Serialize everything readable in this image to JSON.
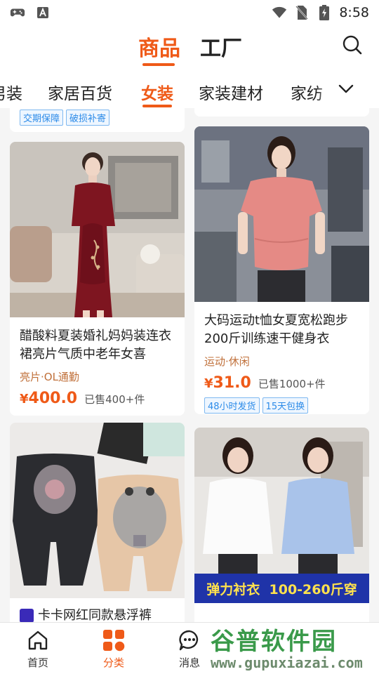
{
  "status_bar": {
    "time": "8:58",
    "left_icons": [
      "gamepad-icon",
      "a-letter-icon"
    ],
    "right_icons": [
      "wifi-icon",
      "no-sim-icon",
      "battery-charging-icon"
    ]
  },
  "header": {
    "tabs": [
      {
        "label": "商品",
        "active": true
      },
      {
        "label": "工厂",
        "active": false
      }
    ],
    "search_icon": "search-icon"
  },
  "categories": {
    "items": [
      {
        "label": "男装",
        "active": false
      },
      {
        "label": "家居百货",
        "active": false
      },
      {
        "label": "女装",
        "active": true
      },
      {
        "label": "家装建材",
        "active": false
      },
      {
        "label": "家纺",
        "active": false
      }
    ],
    "expand_icon": "chevron-down-icon"
  },
  "feed": {
    "partial_top_badges": [
      "交期保障",
      "破损补寄"
    ],
    "products": [
      {
        "title": "醋酸料夏装婚礼妈妈装连衣裙亮片气质中老年女喜",
        "tag": "亮片·OL通勤",
        "price_symbol": "¥",
        "price": "400.0",
        "sold": "已售400+件",
        "badges": []
      },
      {
        "title": "大码运动t恤女夏宽松跑步200斤训练速干健身衣",
        "tag": "运动·休闲",
        "price_symbol": "¥",
        "price": "31.0",
        "sold": "已售1000+件",
        "badges": [
          "48小时发货",
          "15天包换"
        ]
      },
      {
        "title": "卡卡网红同款悬浮裤",
        "tag": "",
        "price_symbol": "",
        "price": "",
        "sold": "",
        "badges": []
      },
      {
        "title": "",
        "image_banner": "弹力衬衣  100-260斤穿",
        "tag": "",
        "price_symbol": "",
        "price": "",
        "sold": "",
        "badges": []
      }
    ]
  },
  "bottom_nav": {
    "items": [
      {
        "label": "首页",
        "icon": "home-icon",
        "active": false
      },
      {
        "label": "分类",
        "icon": "category-grid-icon",
        "active": true
      },
      {
        "label": "消息",
        "icon": "message-icon",
        "active": false
      }
    ]
  },
  "watermark": {
    "title": "谷普软件园",
    "url": "www.gupuxiazai.com"
  },
  "colors": {
    "accent": "#ef5a18",
    "badge_blue": "#2c8be8",
    "tag_brown": "#c0703a"
  }
}
